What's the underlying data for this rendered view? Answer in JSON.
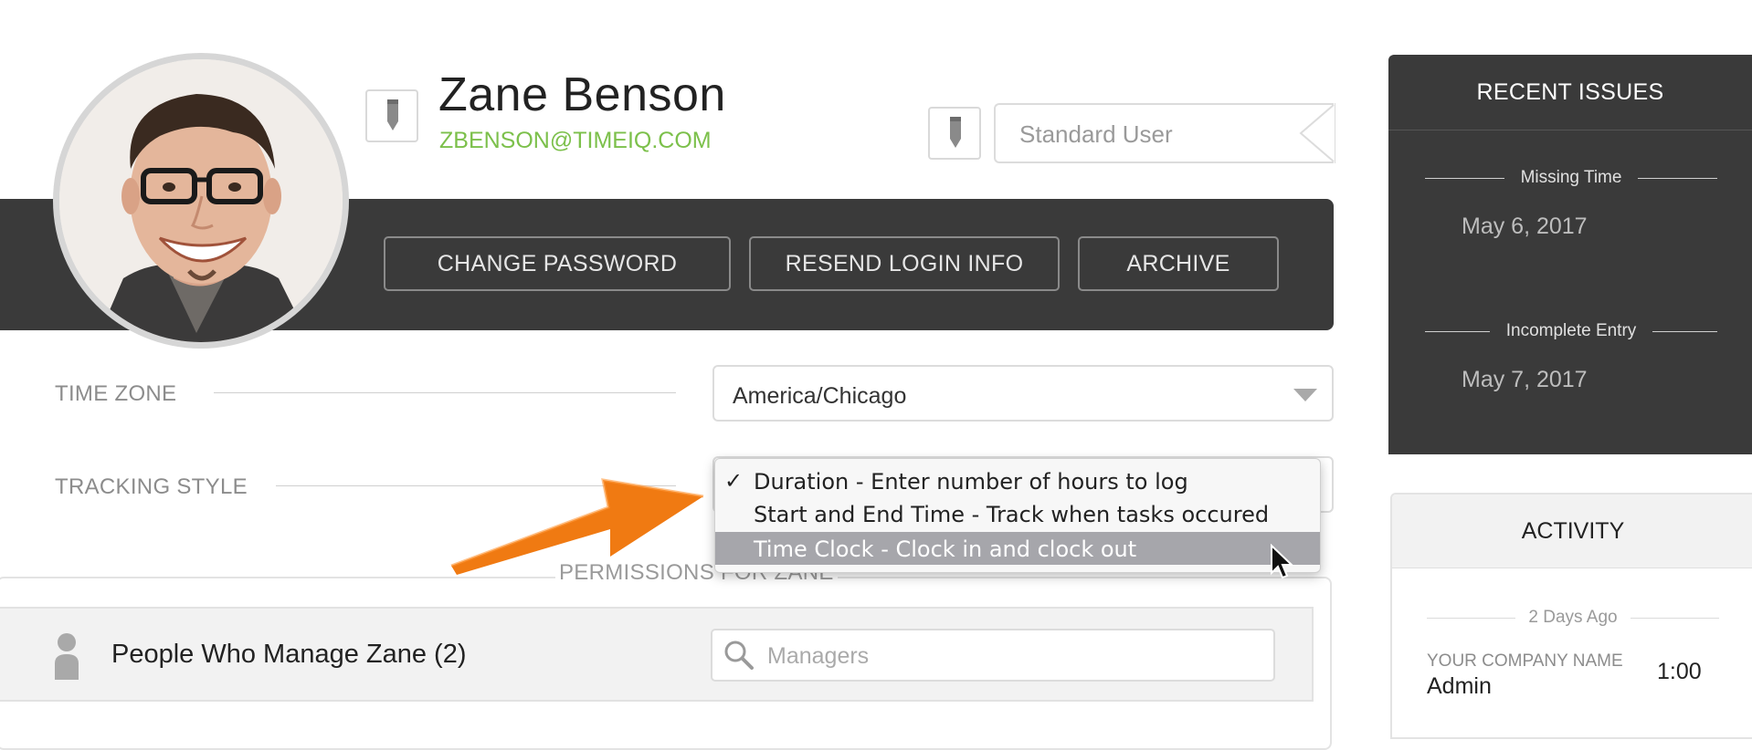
{
  "profile": {
    "name": "Zane Benson",
    "email": "ZBENSON@TIMEIQ.COM",
    "role": "Standard User",
    "actions": {
      "change_password": "CHANGE PASSWORD",
      "resend_login": "RESEND LOGIN INFO",
      "archive": "ARCHIVE"
    },
    "icons": {
      "edit": "pencil-icon",
      "avatar": "user-photo"
    }
  },
  "settings": {
    "time_zone": {
      "label": "TIME ZONE",
      "value": "America/Chicago"
    },
    "tracking_style": {
      "label": "TRACKING STYLE",
      "options": [
        {
          "label": "Duration - Enter number of hours to log",
          "checked": true,
          "highlighted": false
        },
        {
          "label": "Start and End Time - Track when tasks occured",
          "checked": false,
          "highlighted": false
        },
        {
          "label": "Time Clock - Clock in and clock out",
          "checked": false,
          "highlighted": true
        }
      ],
      "check_glyph": "✓"
    }
  },
  "permissions": {
    "title": "PERMISSIONS FOR ZANE",
    "managers_row": {
      "label": "People Who Manage Zane (2)",
      "search_placeholder": "Managers",
      "search_value": ""
    }
  },
  "recent_issues": {
    "title": "RECENT ISSUES",
    "items": [
      {
        "type": "Missing Time",
        "date": "May 6, 2017"
      },
      {
        "type": "Incomplete Entry",
        "date": "May 7, 2017"
      }
    ]
  },
  "activity": {
    "title": "ACTIVITY",
    "entries": [
      {
        "when": "2 Days Ago",
        "company": "YOUR COMPANY NAME",
        "user": "Admin",
        "duration": "1:00"
      }
    ]
  },
  "colors": {
    "dark_band": "#3a3a3a",
    "email_green": "#7cc04b",
    "menu_highlight": "#a6a6ab",
    "annotation_arrow": "#f07a12"
  }
}
